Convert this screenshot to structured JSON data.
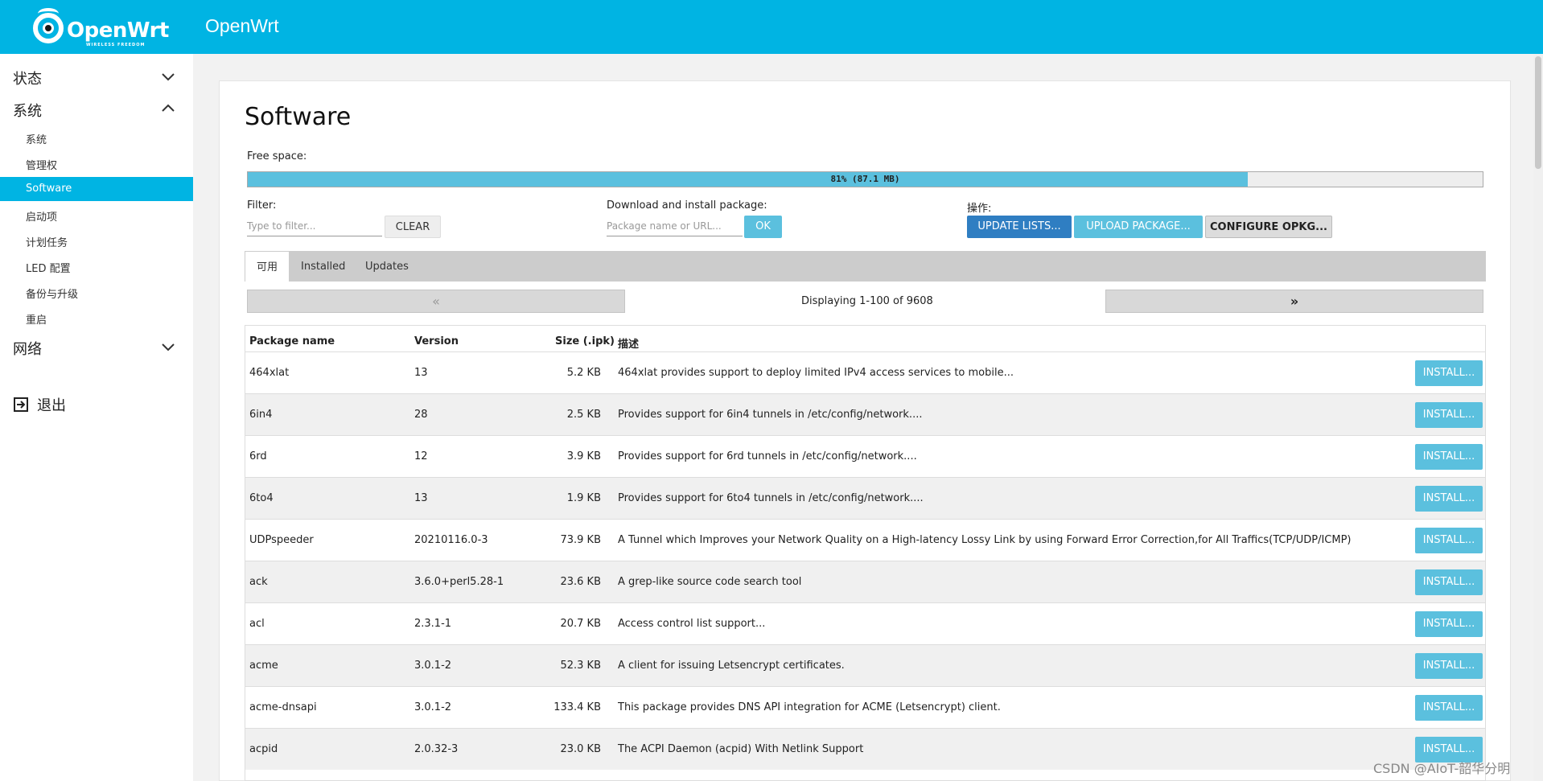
{
  "header": {
    "logo_text": "OpenWrt",
    "logo_subtext": "WIRELESS FREEDOM",
    "brand": "OpenWrt",
    "accent_color": "#00b4e3"
  },
  "sidebar": {
    "groups": [
      {
        "label": "状态",
        "icon": "chevron-down-icon"
      },
      {
        "label": "系统",
        "icon": "chevron-up-icon"
      },
      {
        "label": "网络",
        "icon": "chevron-down-icon"
      }
    ],
    "system_items": [
      {
        "label": "系统"
      },
      {
        "label": "管理权"
      },
      {
        "label": "Software",
        "active": true
      },
      {
        "label": "启动项"
      },
      {
        "label": "计划任务"
      },
      {
        "label": "LED 配置"
      },
      {
        "label": "备份与升级"
      },
      {
        "label": "重启"
      }
    ],
    "logout": {
      "label": "退出",
      "icon": "logout-icon"
    }
  },
  "page": {
    "title": "Software",
    "free_space_label": "Free space:",
    "free_space_text": "81% (87.1 MB)",
    "free_space_fraction": 0.81,
    "filter": {
      "label": "Filter:",
      "placeholder": "Type to filter...",
      "clear": "CLEAR"
    },
    "download": {
      "label": "Download and install package:",
      "placeholder": "Package name or URL...",
      "ok": "OK"
    },
    "actions": {
      "label": "操作:",
      "update": "UPDATE LISTS...",
      "upload": "UPLOAD PACKAGE...",
      "configure": "CONFIGURE OPKG..."
    },
    "tabs": [
      "可用",
      "Installed",
      "Updates"
    ],
    "pager": {
      "prev": "«",
      "next": "»",
      "status": "Displaying 1-100 of 9608"
    },
    "columns": {
      "name": "Package name",
      "version": "Version",
      "size": "Size (.ipk)",
      "desc": "描述"
    },
    "install_label": "INSTALL...",
    "packages": [
      {
        "name": "464xlat",
        "version": "13",
        "size": "5.2 KB",
        "desc": "464xlat provides support to deploy limited IPv4 access services to mobile..."
      },
      {
        "name": "6in4",
        "version": "28",
        "size": "2.5 KB",
        "desc": "Provides support for 6in4 tunnels in /etc/config/network...."
      },
      {
        "name": "6rd",
        "version": "12",
        "size": "3.9 KB",
        "desc": "Provides support for 6rd tunnels in /etc/config/network...."
      },
      {
        "name": "6to4",
        "version": "13",
        "size": "1.9 KB",
        "desc": "Provides support for 6to4 tunnels in /etc/config/network...."
      },
      {
        "name": "UDPspeeder",
        "version": "20210116.0-3",
        "size": "73.9 KB",
        "desc": "A Tunnel which Improves your Network Quality on a High-latency Lossy Link by using Forward Error Correction,for All Traffics(TCP/UDP/ICMP)"
      },
      {
        "name": "ack",
        "version": "3.6.0+perl5.28-1",
        "size": "23.6 KB",
        "desc": "A grep-like source code search tool"
      },
      {
        "name": "acl",
        "version": "2.3.1-1",
        "size": "20.7 KB",
        "desc": "Access control list support..."
      },
      {
        "name": "acme",
        "version": "3.0.1-2",
        "size": "52.3 KB",
        "desc": "A client for issuing Letsencrypt certificates."
      },
      {
        "name": "acme-dnsapi",
        "version": "3.0.1-2",
        "size": "133.4 KB",
        "desc": "This package provides DNS API integration for ACME (Letsencrypt) client."
      },
      {
        "name": "acpid",
        "version": "2.0.32-3",
        "size": "23.0 KB",
        "desc": "The ACPI Daemon (acpid) With Netlink Support"
      }
    ]
  },
  "watermark": "CSDN @AIoT-韶华分明"
}
